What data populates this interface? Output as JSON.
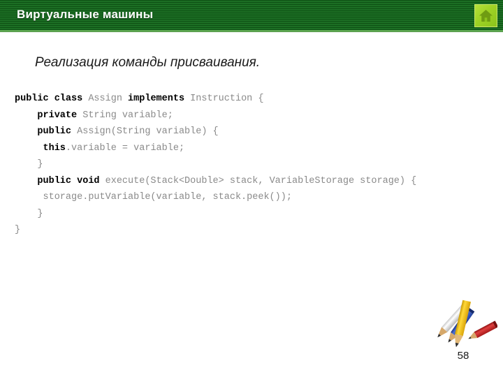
{
  "slide": {
    "header": {
      "title": "Виртуальные машины",
      "bar_color": "#12681a",
      "accent_color": "#7fbe6a",
      "home_icon": "home-icon",
      "home_icon_bg": "#9ed225"
    },
    "subtitle": "Реализация команды присваивания.",
    "code": {
      "language": "java",
      "keyword_color": "#000000",
      "text_color": "#8a8a8a",
      "lines": [
        {
          "indent": 0,
          "segments": [
            {
              "text": "public class ",
              "bold": true
            },
            {
              "text": "Assign ",
              "bold": false
            },
            {
              "text": "implements ",
              "bold": true
            },
            {
              "text": "Instruction {",
              "bold": false
            }
          ]
        },
        {
          "indent": 1,
          "segments": [
            {
              "text": "private ",
              "bold": true
            },
            {
              "text": "String variable;",
              "bold": false
            }
          ]
        },
        {
          "indent": 1,
          "segments": [
            {
              "text": "public ",
              "bold": true
            },
            {
              "text": "Assign(String variable) {",
              "bold": false
            }
          ]
        },
        {
          "indent": 1,
          "segments": [
            {
              "text": " this",
              "bold": true
            },
            {
              "text": ".variable = variable;",
              "bold": false
            }
          ]
        },
        {
          "indent": 1,
          "segments": [
            {
              "text": "}",
              "bold": false
            }
          ]
        },
        {
          "indent": 1,
          "segments": [
            {
              "text": "public void ",
              "bold": true
            },
            {
              "text": "execute(Stack<Double> stack, VariableStorage storage) {",
              "bold": false
            }
          ]
        },
        {
          "indent": 1,
          "segments": [
            {
              "text": " storage.putVariable(variable, stack.peek());",
              "bold": false
            }
          ]
        },
        {
          "indent": 1,
          "segments": [
            {
              "text": "}",
              "bold": false
            }
          ]
        },
        {
          "indent": 0,
          "segments": [
            {
              "text": "}",
              "bold": false
            }
          ]
        }
      ]
    },
    "decoration": {
      "name": "pencils-illustration",
      "pencil_colors": [
        "#ffffff",
        "#f2c21b",
        "#2d52b8",
        "#c42020"
      ]
    },
    "page_number": "58"
  }
}
